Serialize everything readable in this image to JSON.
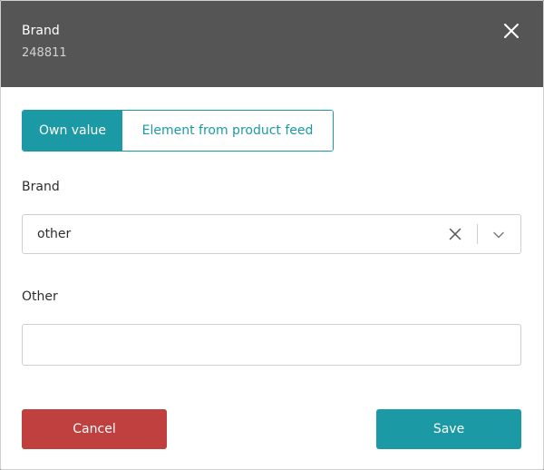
{
  "dialog": {
    "title": "Brand",
    "subtitle": "248811"
  },
  "source_toggle": {
    "options": [
      {
        "label": "Own value",
        "active": true
      },
      {
        "label": "Element from product feed",
        "active": false
      }
    ]
  },
  "brand_field": {
    "label": "Brand",
    "selected_value": "other"
  },
  "other_field": {
    "label": "Other",
    "value": "",
    "placeholder": ""
  },
  "footer": {
    "cancel_label": "Cancel",
    "save_label": "Save"
  },
  "colors": {
    "header_bg": "#555555",
    "accent": "#1b9aa6",
    "danger": "#c04040"
  },
  "icons": {
    "close": "close-icon",
    "clear": "clear-icon",
    "dropdown": "chevron-down-icon"
  }
}
